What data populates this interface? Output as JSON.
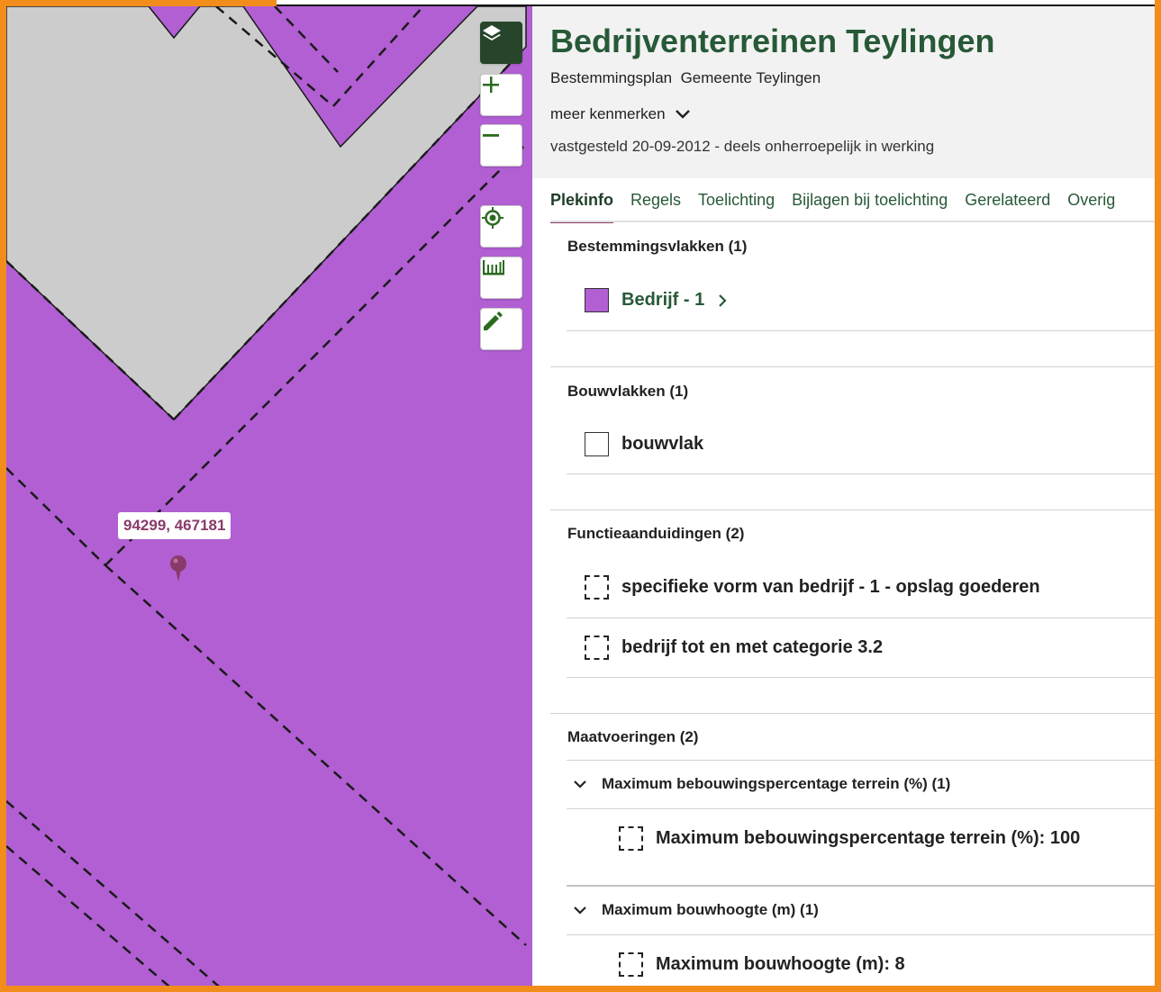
{
  "map": {
    "coordinate_label": "94299, 467181",
    "controls": [
      {
        "name": "layers",
        "icon": "layers-icon"
      },
      {
        "name": "zoom-in",
        "icon": "plus-icon"
      },
      {
        "name": "zoom-out",
        "icon": "minus-icon"
      },
      {
        "name": "locate",
        "icon": "crosshair-icon"
      },
      {
        "name": "measure",
        "icon": "ruler-icon"
      },
      {
        "name": "draw",
        "icon": "pencil-icon"
      }
    ],
    "colors": {
      "plan_area": "#b15fd3",
      "outside_area": "#cccccc",
      "accent": "#27452b"
    }
  },
  "header": {
    "title": "Bedrijventerreinen Teylingen",
    "subtitle": "Bestemmingsplan  Gemeente Teylingen",
    "more_label": "meer kenmerken",
    "status": "vastgesteld 20-09-2012 - deels onherroepelijk in werking"
  },
  "tabs": [
    "Plekinfo",
    "Regels",
    "Toelichting",
    "Bijlagen bij toelichting",
    "Gerelateerd",
    "Overig"
  ],
  "sections": {
    "bestemmingsvlakken": {
      "title": "Bestemmingsvlakken (1)",
      "item": "Bedrijf - 1"
    },
    "bouwvlakken": {
      "title": "Bouwvlakken (1)",
      "item": "bouwvlak"
    },
    "functieaanduidingen": {
      "title": "Functieaanduidingen (2)",
      "items": [
        "specifieke vorm van bedrijf - 1 - opslag goederen",
        "bedrijf tot en met categorie 3.2"
      ]
    },
    "maatvoeringen": {
      "title": "Maatvoeringen (2)",
      "groups": [
        {
          "label": "Maximum bebouwingspercentage terrein (%) (1)",
          "item": "Maximum bebouwingspercentage terrein (%): 100"
        },
        {
          "label": "Maximum bouwhoogte (m) (1)",
          "item": "Maximum bouwhoogte (m): 8"
        }
      ]
    }
  }
}
